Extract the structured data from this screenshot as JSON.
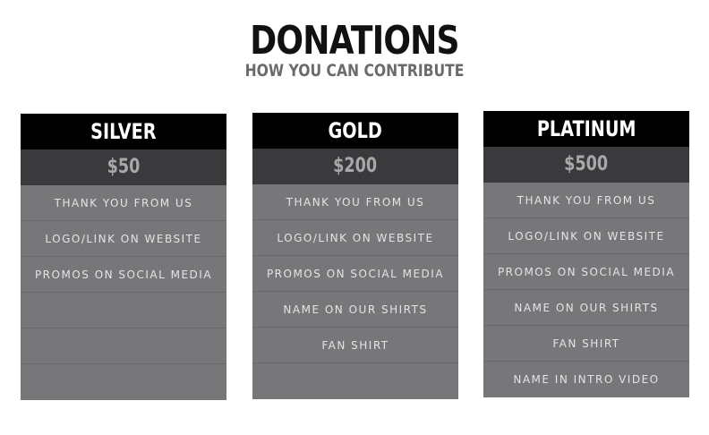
{
  "header": {
    "title": "DONATIONS",
    "subtitle": "HOW YOU CAN CONTRIBUTE"
  },
  "tiers": [
    {
      "name": "SILVER",
      "price": "$50",
      "perks": [
        "THANK YOU FROM US",
        "LOGO/LINK ON WEBSITE",
        "PROMOS ON SOCIAL MEDIA",
        "",
        "",
        ""
      ]
    },
    {
      "name": "GOLD",
      "price": "$200",
      "perks": [
        "THANK YOU FROM US",
        "LOGO/LINK ON WEBSITE",
        "PROMOS ON SOCIAL MEDIA",
        "NAME ON OUR SHIRTS",
        "FAN SHIRT",
        ""
      ]
    },
    {
      "name": "PLATINUM",
      "price": "$500",
      "perks": [
        "THANK YOU FROM US",
        "LOGO/LINK ON WEBSITE",
        "PROMOS ON SOCIAL MEDIA",
        "NAME ON OUR SHIRTS",
        "FAN SHIRT",
        "NAME IN INTRO VIDEO"
      ]
    }
  ],
  "colors": {
    "tier_name_bg": "#000000",
    "price_bg": "#3a3a3c",
    "perk_bg": "#777779",
    "title": "#111111",
    "subtitle": "#6b6b6b"
  }
}
